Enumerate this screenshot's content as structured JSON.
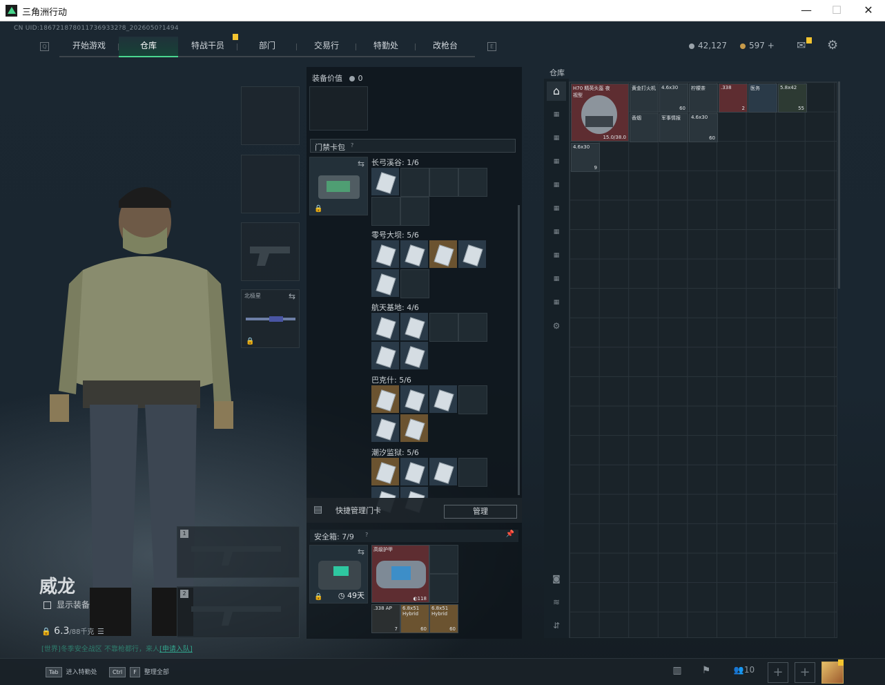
{
  "window": {
    "title": "三角洲行动",
    "minimize": "—",
    "maximize": "☐",
    "close": "✕"
  },
  "uid": "CN UID:1867218780117369332?8_2026050?1494",
  "nav": {
    "tabs": [
      "开始游戏",
      "仓库",
      "特战干员",
      "部门",
      "交易行",
      "特勤处",
      "改枪台"
    ],
    "active": "仓库",
    "left_key": "Q",
    "right_key": "E"
  },
  "currency": {
    "silver": "42,127",
    "gold": "597",
    "gold_plus": "+"
  },
  "character": {
    "name": "威龙",
    "show_equipment": "显示装备",
    "weight_value": "6.3",
    "weight_max": "/88千克",
    "hint_prefix": "[世界]",
    "hint_text": "冬季安全战区 不靠枪都行，来人",
    "hint_link": "[申请入队]"
  },
  "equipment": {
    "melee_label": "北极星",
    "weapon_slot1": "1",
    "weapon_slot2": "2"
  },
  "mid": {
    "equip_value_label": "装备价值",
    "equip_value": "0",
    "keycard_bag_label": "门禁卡包",
    "maps": [
      {
        "name": "长弓溪谷",
        "count": "1/6"
      },
      {
        "name": "零号大坝",
        "count": "5/6"
      },
      {
        "name": "航天基地",
        "count": "4/6"
      },
      {
        "name": "巴克什",
        "count": "5/6"
      },
      {
        "name": "潮汐监狱",
        "count": "5/6"
      }
    ],
    "quick_manage_label": "快捷管理门卡",
    "manage_button": "管理",
    "safebox_label": "安全箱:",
    "safebox_count": "7/9",
    "safebox_days": "49天",
    "armor_label": "高级护甲",
    "armor_value": "118",
    "ammo": [
      {
        "name": ".338 AP",
        "count": "7"
      },
      {
        "name": "6.8x51 Hybrid",
        "count": "60"
      },
      {
        "name": "6.8x51 Hybrid",
        "count": "60"
      }
    ]
  },
  "warehouse": {
    "label": "仓库",
    "helmet": {
      "name": "H70 精英头盔 夜视型",
      "durability": "15.0/38.0"
    },
    "items": [
      {
        "name": "黄金打火机",
        "count": ""
      },
      {
        "name": "4.6x30",
        "count": "60"
      },
      {
        "name": "柠檬茶",
        "count": ""
      },
      {
        "name": ".338",
        "count": "2"
      },
      {
        "name": "医务",
        "count": ""
      },
      {
        "name": "5.8x42",
        "count": "55"
      },
      {
        "name": "香烟",
        "count": ""
      },
      {
        "name": "军事情报",
        "count": ""
      },
      {
        "name": "4.6x30",
        "count": "60"
      },
      {
        "name": "4.6x30",
        "count": "9"
      }
    ]
  },
  "bottom": {
    "hotkeys": [
      {
        "key": "Tab",
        "label": "进入特勤处"
      },
      {
        "key": "Ctrl",
        "key2": "F",
        "label": "整理全部"
      }
    ],
    "friends": "10"
  },
  "colors": {
    "accent": "#4bd891",
    "badge": "#f4c430",
    "gold_item": "#6b5330",
    "red_item": "#5e2d31",
    "blue_item": "#2a3a48"
  }
}
